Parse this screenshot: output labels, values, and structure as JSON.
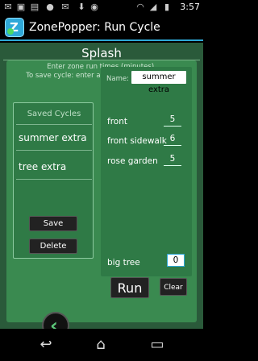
{
  "status_bar": {
    "time": "3:57",
    "icons": [
      "mail-icon",
      "image-icon",
      "sim-icon",
      "pinterest-icon",
      "gmail-icon",
      "download-icon",
      "chrome-icon",
      "wifi-icon",
      "signal-icon",
      "battery-icon"
    ]
  },
  "action_bar": {
    "title": "ZonePopper: Run Cycle",
    "icon_letter": "Z"
  },
  "screen": {
    "title": "Splash",
    "instruction_line1": "Enter zone run times (minutes).",
    "instruction_line2": "To save cycle: enter a name AND click save."
  },
  "saved_cycles": {
    "header": "Saved Cycles",
    "items": [
      {
        "label": "summer extra"
      },
      {
        "label": "tree extra"
      }
    ],
    "save_label": "Save",
    "delete_label": "Delete"
  },
  "cycle_form": {
    "name_label": "Name:",
    "name_value": "summer extra",
    "zones": [
      {
        "label": "front",
        "value": "5"
      },
      {
        "label": "front sidewalk",
        "value": "6"
      },
      {
        "label": "rose garden",
        "value": "5"
      },
      {
        "label": "big tree",
        "value": "0"
      }
    ],
    "run_label": "Run",
    "clear_label": "Clear"
  },
  "colors": {
    "background": "#2a5a3a",
    "panel": "#3a8a50",
    "accent": "#2ea8d6"
  }
}
